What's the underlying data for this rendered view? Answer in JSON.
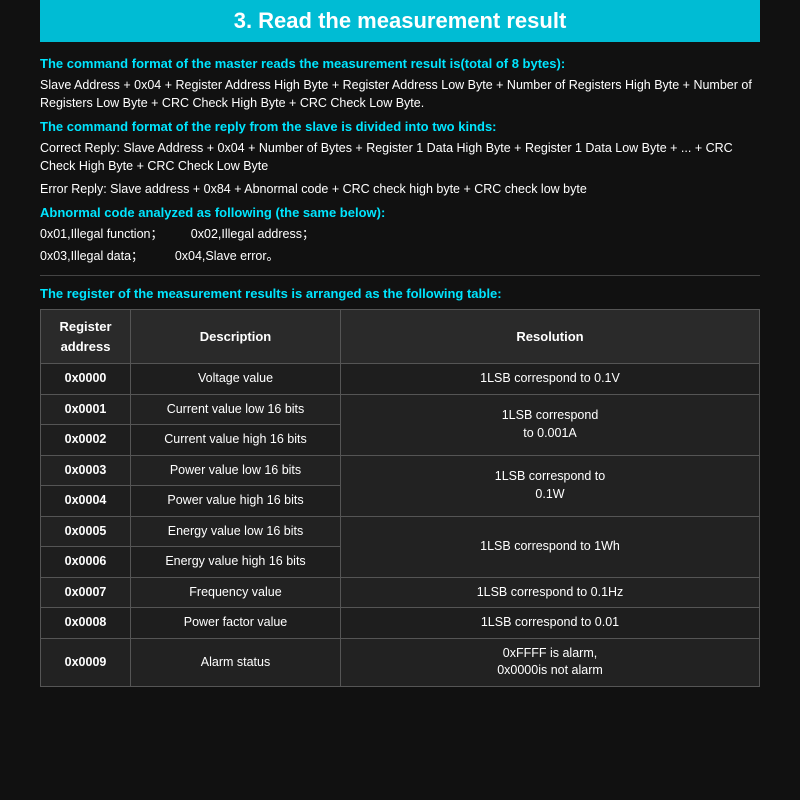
{
  "page": {
    "title": "3. Read the measurement result",
    "section1": {
      "heading": "The command format of the master reads the measurement result is(total of 8 bytes):",
      "body": "Slave Address + 0x04 + Register Address High Byte + Register Address Low Byte + Number of Registers High Byte + Number of Registers Low Byte + CRC Check High Byte + CRC Check Low Byte."
    },
    "section2": {
      "heading": "The command format of the reply from the slave is divided into two kinds:",
      "correct": "Correct Reply: Slave Address + 0x04 + Number of Bytes + Register 1 Data High Byte + Register 1 Data Low Byte + ... + CRC Check High Byte + CRC Check Low Byte",
      "error": "Error Reply: Slave address + 0x84 + Abnormal code + CRC check high byte + CRC check low byte"
    },
    "section3": {
      "heading": "Abnormal code analyzed as following (the same below):",
      "codes": [
        {
          "code": "0x01,Illegal function；",
          "code2": "0x02,Illegal address；"
        },
        {
          "code": "0x03,Illegal data；",
          "code2": "0x04,Slave error。"
        }
      ]
    },
    "table_section": {
      "heading": "The register of the measurement results is arranged as the following table:",
      "headers": [
        "Register address",
        "Description",
        "Resolution"
      ],
      "rows": [
        {
          "address": "0x0000",
          "description": "Voltage value",
          "resolution": "1LSB correspond to 0.1V"
        },
        {
          "address": "0x0001",
          "description": "Current value low 16 bits",
          "resolution": "1LSB correspond\nto 0.001A"
        },
        {
          "address": "0x0002",
          "description": "Current value high 16 bits",
          "resolution": ""
        },
        {
          "address": "0x0003",
          "description": "Power value low 16 bits",
          "resolution": "1LSB correspond to\n0.1W"
        },
        {
          "address": "0x0004",
          "description": "Power value high 16 bits",
          "resolution": ""
        },
        {
          "address": "0x0005",
          "description": "Energy value low 16 bits",
          "resolution": "1LSB correspond to 1Wh"
        },
        {
          "address": "0x0006",
          "description": "Energy value high 16 bits",
          "resolution": ""
        },
        {
          "address": "0x0007",
          "description": "Frequency value",
          "resolution": "1LSB correspond to 0.1Hz"
        },
        {
          "address": "0x0008",
          "description": "Power factor value",
          "resolution": "1LSB correspond to 0.01"
        },
        {
          "address": "0x0009",
          "description": "Alarm status",
          "resolution": "0xFFFF is alarm,\n0x0000is not alarm"
        }
      ]
    }
  }
}
